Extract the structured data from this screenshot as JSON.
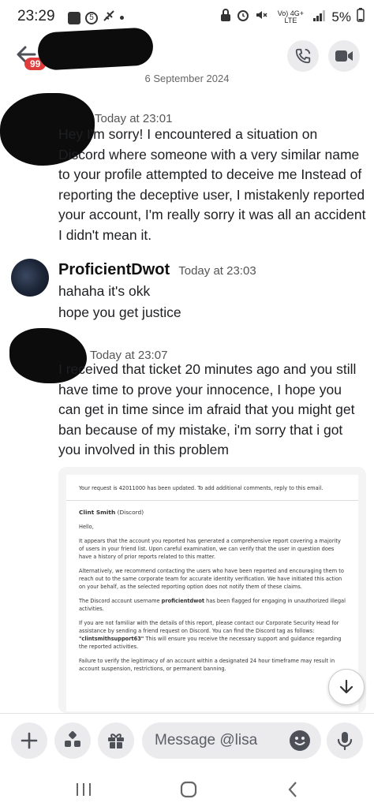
{
  "status_bar": {
    "time": "23:29",
    "notif_count": "5",
    "network": "Vo) 4G+ LTE",
    "battery": "5%"
  },
  "header": {
    "unread_badge": "99",
    "date_separator": "6 September 2024"
  },
  "messages": [
    {
      "author": "",
      "timestamp": "Today at 23:01",
      "lines": [
        "Hey I'm sorry! I encountered a situation on Discord where someone with a very similar name to your profile attempted to deceive me Instead of reporting the deceptive user, I mistakenly reported your account, I'm really sorry it was all an accident I didn't mean it."
      ]
    },
    {
      "author": "ProficientDwot",
      "timestamp": "Today at 23:03",
      "lines": [
        "hahaha it's okk",
        "hope you get justice"
      ]
    },
    {
      "author": "",
      "timestamp": "Today at 23:07",
      "lines": [
        "I received that ticket 20 minutes ago and you still have time to prove your innocence, I hope you can get in time since im afraid that you might get ban because of my mistake, i'm sorry that i got you involved in this problem"
      ]
    }
  ],
  "attachment_email": {
    "update_notice": "Your request is 42011000 has been updated. To add additional comments, reply to this email.",
    "sender": "Clint Smith",
    "sender_org": "(Discord)",
    "greeting": "Hello,",
    "para1": "It appears that the account you reported has generated a comprehensive report covering a majority of users in your friend list. Upon careful examination, we can verify that the user in question does have a history of prior reports related to this matter.",
    "para2": "Alternatively, we recommend contacting the users who have been reported and encouraging them to reach out to the same corporate team for accurate identity verification. We have initiated this action on your behalf, as the selected reporting option does not notify them of these claims.",
    "para3_pre": "The Discord account username ",
    "para3_user": "proficientdwot",
    "para3_post": " has been flagged for engaging in unauthorized illegal activities.",
    "para4_pre": "If you are not familiar with the details of this report, please contact our Corporate Security Head for assistance by sending a friend request on Discord. You can find the Discord tag as follows: ",
    "para4_tag": "\"clintsmithsupport63\"",
    "para4_post": " This will ensure you receive the necessary support and guidance regarding the reported activities.",
    "para5": "Failure to verify the legitimacy of an account within a designated 24 hour timeframe may result in account suspension, restrictions, or permanent banning."
  },
  "composer": {
    "placeholder": "Message @lisa"
  },
  "icons": {
    "back": "arrow-left-icon",
    "call": "phone-icon",
    "video": "video-camera-icon",
    "add": "plus-icon",
    "apps": "apps-icon",
    "gift": "gift-icon",
    "emoji": "emoji-icon",
    "mic": "microphone-icon",
    "scroll": "chevron-down-icon"
  },
  "colors": {
    "badge": "#e03c3c",
    "button_bg": "#ebebee"
  }
}
